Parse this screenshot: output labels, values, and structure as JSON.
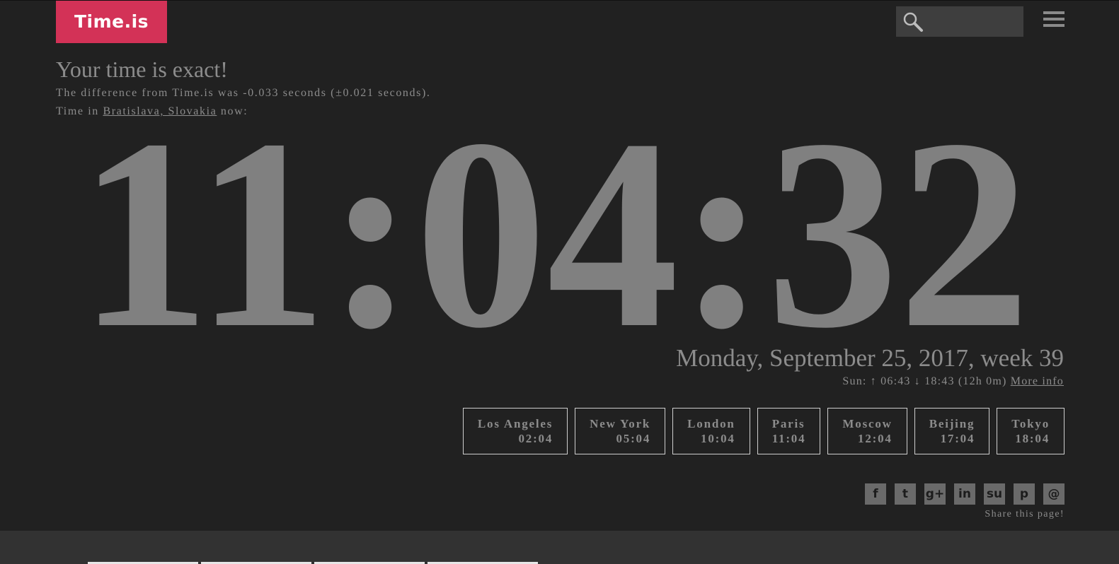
{
  "logo": {
    "text": "Time.is"
  },
  "search": {
    "placeholder": ""
  },
  "icons": {
    "search": "search-icon",
    "menu": "hamburger-menu-icon"
  },
  "status": {
    "title": "Your time is exact!",
    "difference": "The difference from Time.is was -0.033 seconds (±0.021 seconds).",
    "location_prefix": "Time in ",
    "location": "Bratislava, Slovakia",
    "location_suffix": " now:"
  },
  "clock": {
    "time": "11:04:32"
  },
  "date": {
    "text": "Monday, September 25, 2017, week 39"
  },
  "sun": {
    "text": "Sun: ↑ 06:43 ↓ 18:43 (12h 0m) ",
    "more_info": "More info"
  },
  "cities": [
    {
      "name": "Los Angeles",
      "time": "02:04"
    },
    {
      "name": "New York",
      "time": "05:04"
    },
    {
      "name": "London",
      "time": "10:04"
    },
    {
      "name": "Paris",
      "time": "11:04"
    },
    {
      "name": "Moscow",
      "time": "12:04"
    },
    {
      "name": "Beijing",
      "time": "17:04"
    },
    {
      "name": "Tokyo",
      "time": "18:04"
    }
  ],
  "share": {
    "buttons": [
      {
        "icon": "facebook-icon",
        "glyph": "f"
      },
      {
        "icon": "twitter-icon",
        "glyph": "t"
      },
      {
        "icon": "google-plus-icon",
        "glyph": "g+"
      },
      {
        "icon": "linkedin-icon",
        "glyph": "in"
      },
      {
        "icon": "stumbleupon-icon",
        "glyph": "su"
      },
      {
        "icon": "pinterest-icon",
        "glyph": "p"
      },
      {
        "icon": "email-icon",
        "glyph": "@"
      }
    ],
    "label": "Share this page!"
  },
  "colors": {
    "background": "#212121",
    "brand": "#d33257",
    "text": "#8c8c8c",
    "clock": "#808080"
  }
}
